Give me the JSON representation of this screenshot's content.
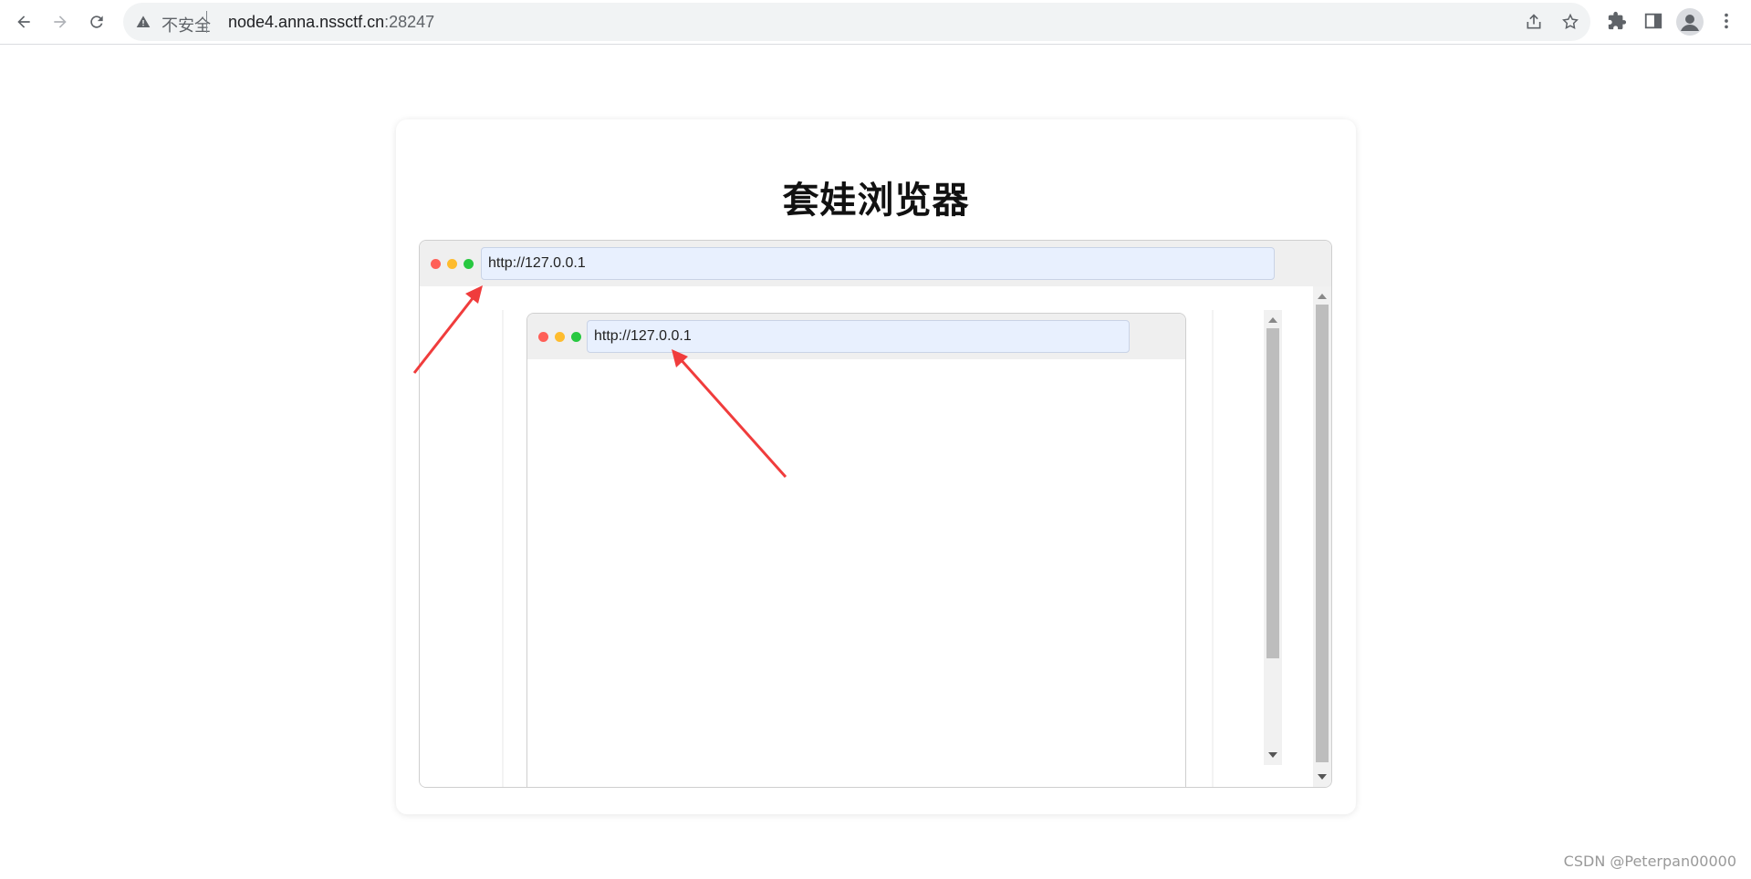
{
  "browser": {
    "security_label": "不安全",
    "url_host": "node4.anna.nssctf.cn",
    "url_port": ":28247"
  },
  "page": {
    "title": "套娃浏览器"
  },
  "outer_browser": {
    "url_value": "http://127.0.0.1"
  },
  "inner_browser": {
    "url_value": "http://127.0.0.1"
  },
  "watermark": "CSDN @Peterpan00000",
  "colors": {
    "dot_red": "#ff5f57",
    "dot_yellow": "#febc2e",
    "dot_green": "#28c840",
    "annotation_arrow": "#f03c3c"
  }
}
